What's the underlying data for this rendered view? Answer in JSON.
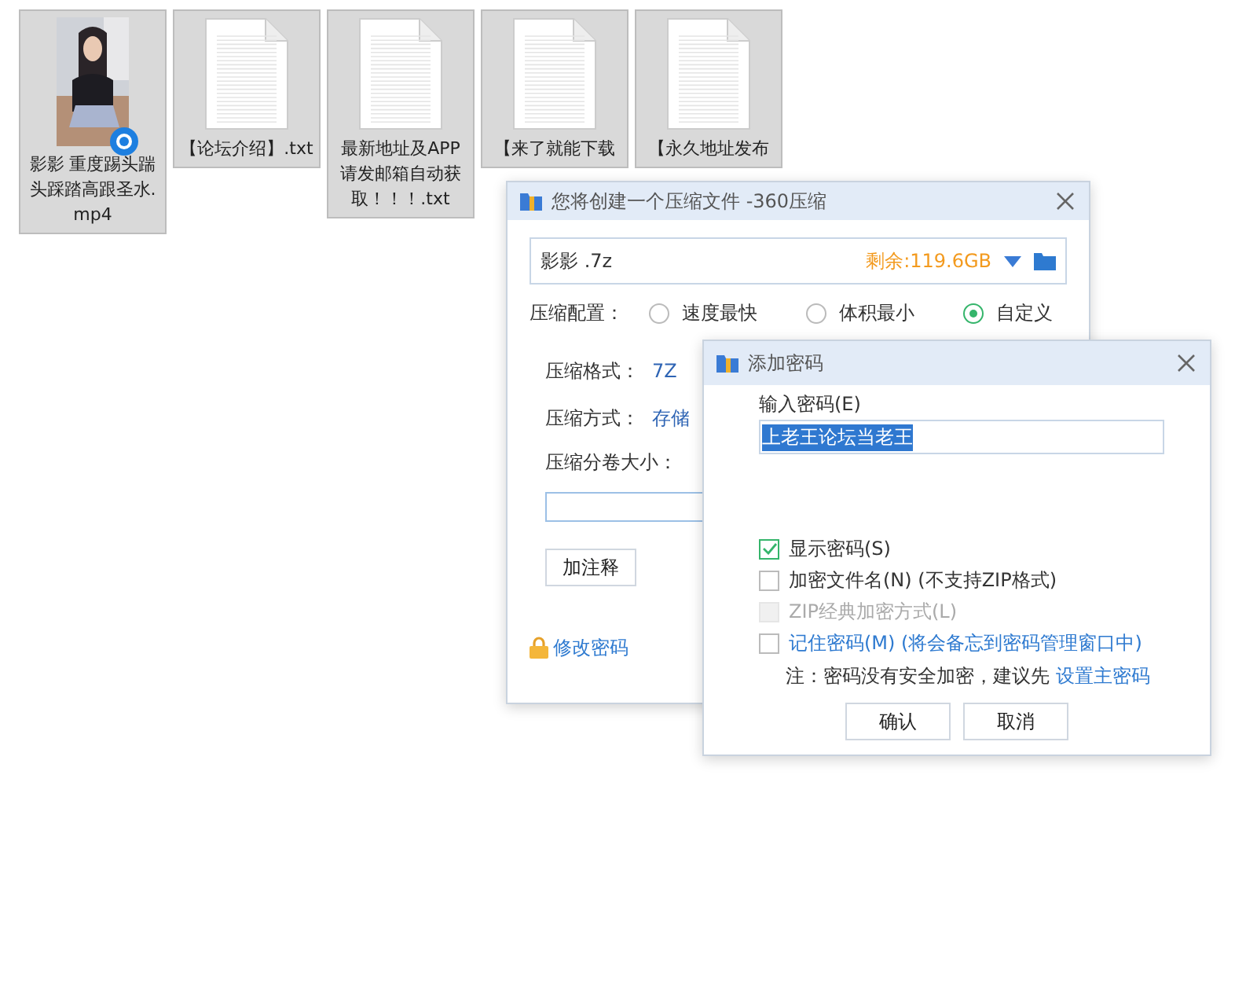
{
  "files": [
    {
      "kind": "video",
      "label_lines": [
        "影影 重度踢头踹",
        "头踩踏高跟圣水.",
        "mp4"
      ]
    },
    {
      "kind": "text",
      "label_lines": [
        "【论坛介绍】.txt"
      ]
    },
    {
      "kind": "text",
      "label_lines": [
        "最新地址及APP",
        "请发邮箱自动获",
        "取！！！.txt"
      ]
    },
    {
      "kind": "text",
      "label_lines": [
        "【来了就能下载"
      ]
    },
    {
      "kind": "text",
      "label_lines": [
        "【永久地址发布"
      ]
    }
  ],
  "compress_dialog": {
    "title": "您将创建一个压缩文件 -360压缩",
    "filename": "影影 .7z",
    "free_space": "剩余:119.6GB",
    "config_label": "压缩配置：",
    "config_options": [
      {
        "label": "速度最快",
        "selected": false
      },
      {
        "label": "体积最小",
        "selected": false
      },
      {
        "label": "自定义",
        "selected": true
      }
    ],
    "format_label": "压缩格式：",
    "format_value": "7Z",
    "method_label": "压缩方式：",
    "method_value": "存储",
    "split_label": "压缩分卷大小：",
    "comment_button": "加注释",
    "change_password_link": "修改密码"
  },
  "password_dialog": {
    "title": "添加密码",
    "input_label": "输入密码(E)",
    "password": "上老王论坛当老王",
    "options": [
      {
        "label": "显示密码(S)",
        "checked": true,
        "disabled": false,
        "link": false
      },
      {
        "label": "加密文件名(N) (不支持ZIP格式)",
        "checked": false,
        "disabled": false,
        "link": false
      },
      {
        "label": "ZIP经典加密方式(L)",
        "checked": false,
        "disabled": true,
        "link": false
      },
      {
        "label": "记住密码(M) (将会备忘到密码管理窗口中)",
        "checked": false,
        "disabled": false,
        "link": true
      }
    ],
    "note": "注：密码没有安全加密，建议先",
    "note_link": "设置主密码",
    "buttons": [
      "确认",
      "取消"
    ]
  }
}
